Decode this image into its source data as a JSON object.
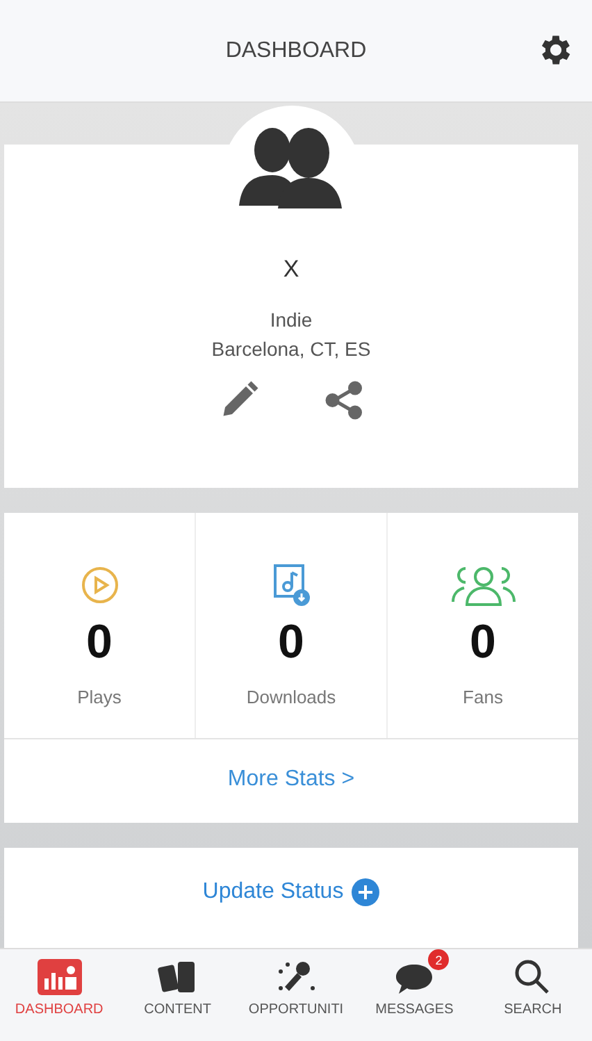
{
  "header": {
    "title": "DASHBOARD"
  },
  "profile": {
    "name": "X",
    "genre": "Indie",
    "location": "Barcelona, CT, ES"
  },
  "stats": [
    {
      "kind": "plays",
      "value": "0",
      "label": "Plays"
    },
    {
      "kind": "downloads",
      "value": "0",
      "label": "Downloads"
    },
    {
      "kind": "fans",
      "value": "0",
      "label": "Fans"
    }
  ],
  "more_stats": "More Stats >",
  "update_status": "Update Status",
  "nav": [
    {
      "kind": "dashboard",
      "label": "DASHBOARD",
      "selected": true
    },
    {
      "kind": "content",
      "label": "CONTENT",
      "selected": false
    },
    {
      "kind": "opportunities",
      "label": "OPPORTUNITI",
      "selected": false
    },
    {
      "kind": "messages",
      "label": "MESSAGES",
      "selected": false,
      "badge": "2"
    },
    {
      "kind": "search",
      "label": "SEARCH",
      "selected": false
    }
  ]
}
